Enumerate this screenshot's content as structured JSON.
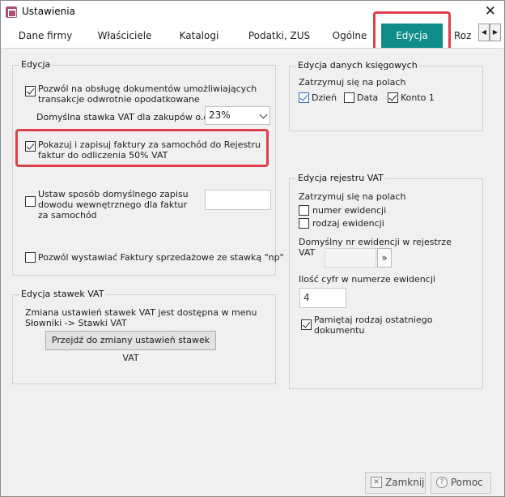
{
  "window": {
    "title": "Ustawienia"
  },
  "tabs": [
    {
      "label": "Dane firmy"
    },
    {
      "label": "Właściciele"
    },
    {
      "label": "Katalogi"
    },
    {
      "label": "Podatki, ZUS"
    },
    {
      "label": "Ogólne"
    },
    {
      "label": "Edycja",
      "active": true
    },
    {
      "label": "Roz"
    }
  ],
  "colors": {
    "accent_tab": "#0f8d8a",
    "highlight": "#e03e4a"
  },
  "edycja": {
    "title": "Edycja",
    "reverse_charge": {
      "label_line1": "Pozwól na obsługę dokumentów umożliwiających",
      "label_line2": "transakcje odwrotnie opodatkowane",
      "checked": true
    },
    "vat_rate_label": "Domyślna stawka VAT dla zakupów o.o.",
    "vat_rate_value": "23%",
    "car_invoices": {
      "label_line1": "Pokazuj i zapisuj faktury za samochód do Rejestru",
      "label_line2": "faktur  do odliczenia 50% VAT",
      "checked": true
    },
    "internal_doc": {
      "label_line1": "Ustaw sposób domyślnego zapisu",
      "label_line2": "dowodu wewnętrznego dla faktur",
      "label_line3": "za samochód",
      "checked": false
    },
    "np_invoices": {
      "label": "Pozwól wystawiać Faktury sprzedażowe  ze stawką \"np\"",
      "checked": false
    }
  },
  "stawki": {
    "title": "Edycja stawek VAT",
    "info_line1": "Zmiana ustawień stawek VAT jest dostępna  w menu",
    "info_line2": "Słowniki -> Stawki VAT",
    "button": "Przejdź do zmiany ustawień stawek VAT"
  },
  "ksiegowe": {
    "title": "Edycja danych księgowych",
    "stop_label": "Zatrzymuj się na polach",
    "fields": [
      {
        "label": "Dzień",
        "checked": true
      },
      {
        "label": "Data",
        "checked": false
      },
      {
        "label": "Konto 1",
        "checked": true
      }
    ]
  },
  "rejestr": {
    "title": "Edycja rejestru VAT",
    "stop_label": "Zatrzymuj się na polach",
    "numer_ewidencji": {
      "label": "numer ewidencji",
      "checked": false
    },
    "rodzaj_ewidencji": {
      "label": "rodzaj ewidencji",
      "checked": false
    },
    "nr_label_line1": "Domyślny nr ewidencji w rejestrze",
    "nr_label_line2": "VAT",
    "nr_value": "",
    "nr_button": "»",
    "digits_label": "Ilość cyfr w numerze ewidencji",
    "digits_value": "4",
    "remember": {
      "label_line1": "Pamiętaj rodzaj ostatniego",
      "label_line2": "dokumentu",
      "checked": true
    }
  },
  "footer": {
    "close_label": "Zamknij",
    "help_label": "Pomoc"
  }
}
